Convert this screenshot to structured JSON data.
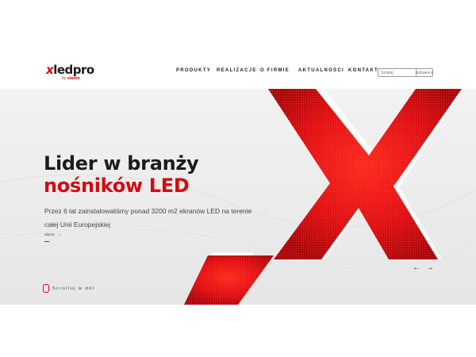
{
  "brand": {
    "logo_main": "ledpro",
    "logo_x": "x",
    "logo_by": "by",
    "logo_company": "statim",
    "accent_color": "#d60a10"
  },
  "nav": {
    "items": [
      {
        "label": "PRODUKTY"
      },
      {
        "label": "REALIZACJE"
      },
      {
        "label": "O FIRMIE"
      },
      {
        "label": "AKTUALNOŚCI"
      },
      {
        "label": "KONTAKT"
      }
    ]
  },
  "search": {
    "placeholder": "Szukaj",
    "button_label": "SZUKAJ"
  },
  "hero": {
    "title_line1": "Lider w branży",
    "title_line2": "nośników LED",
    "description": "Przez 6 lat zainstalowaliśmy ponad 3200 m2 ekranów LED na terenie całej Unii Europejskiej",
    "more_label": "więcej",
    "more_arrow": "→",
    "scroll_label": "Scrolluj w dół",
    "prev_icon": "←",
    "next_icon": "→"
  }
}
